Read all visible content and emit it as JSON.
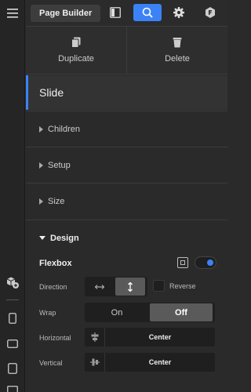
{
  "topbar": {
    "page_builder_label": "Page Builder"
  },
  "actions": {
    "duplicate_label": "Duplicate",
    "delete_label": "Delete"
  },
  "element": {
    "title": "Slide"
  },
  "sections": {
    "children": "Children",
    "setup": "Setup",
    "size": "Size",
    "design": "Design"
  },
  "design": {
    "flexbox_label": "Flexbox",
    "flexbox_enabled": true,
    "direction": {
      "label": "Direction",
      "options": [
        "horizontal-arrows-icon",
        "vertical-arrows-icon"
      ],
      "selected": "vertical",
      "reverse_label": "Reverse",
      "reverse_checked": false
    },
    "wrap": {
      "label": "Wrap",
      "on_label": "On",
      "off_label": "Off",
      "selected": "Off"
    },
    "horizontal": {
      "label": "Horizontal",
      "value": "Center"
    },
    "vertical": {
      "label": "Vertical",
      "value": "Center"
    }
  },
  "colors": {
    "accent": "#3b82f6",
    "panel": "#2a2a2a",
    "field": "#1f1f1f"
  }
}
